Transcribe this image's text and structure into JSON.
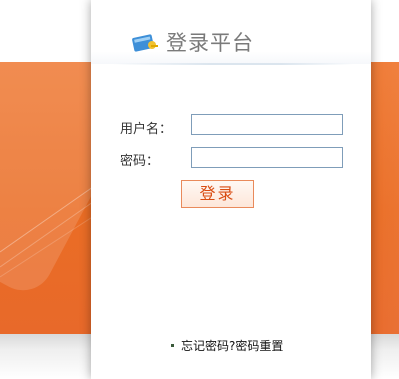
{
  "header": {
    "title": "登录平台",
    "icon": "login-platform-icon"
  },
  "form": {
    "username_label": "用户名：",
    "username_value": "",
    "password_label": "密码：",
    "password_value": "",
    "submit_label": "登录"
  },
  "footer": {
    "reset_link": "忘记密码?密码重置"
  },
  "colors": {
    "accent": "#ea6d25",
    "button_text": "#d94d13",
    "input_border": "#7f9db9"
  }
}
